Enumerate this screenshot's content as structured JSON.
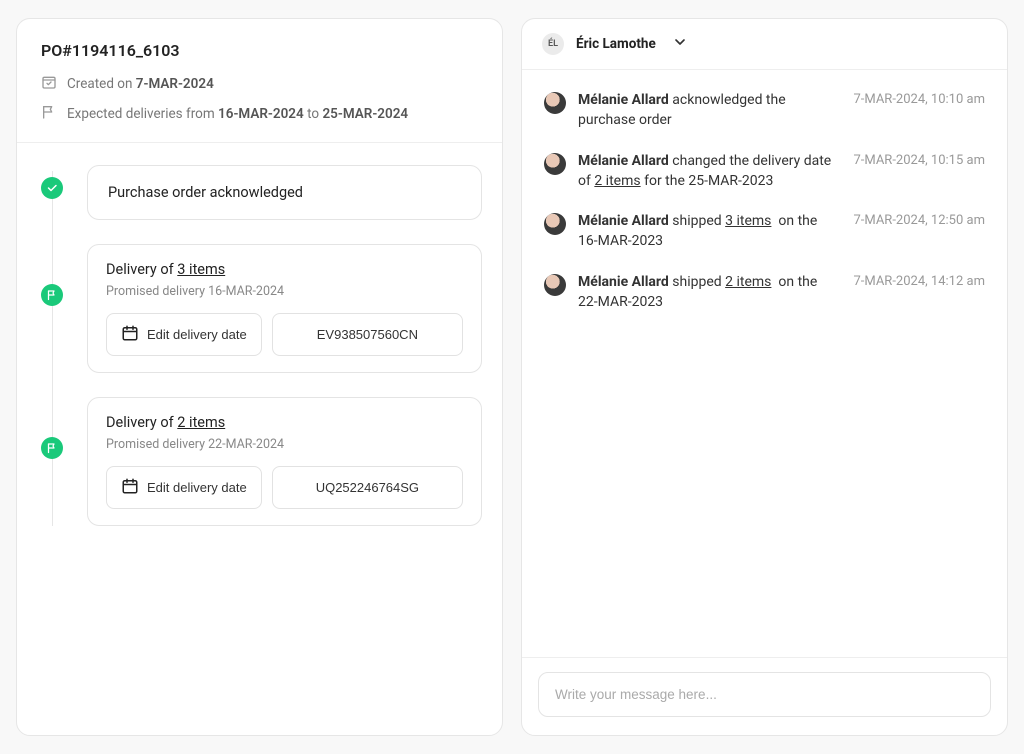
{
  "po": {
    "title": "PO#1194116_6103",
    "created_label": "Created on",
    "created_date": "7-MAR-2024",
    "expected_label_pre": "Expected deliveries from",
    "expected_from": "16-MAR-2024",
    "expected_label_mid": "to",
    "expected_to": "25-MAR-2024"
  },
  "timeline": {
    "ack": "Purchase order acknowledged",
    "edit_label": "Edit delivery date",
    "d1": {
      "title_pre": "Delivery of",
      "items": "3 items",
      "sub_pre": "Promised delivery",
      "sub_date": "16-MAR-2024",
      "tracking": "EV938507560CN"
    },
    "d2": {
      "title_pre": "Delivery of",
      "items": "2 items",
      "sub_pre": "Promised delivery",
      "sub_date": "22-MAR-2024",
      "tracking": "UQ252246764SG"
    }
  },
  "right": {
    "user_initials": "ÉL",
    "user_name": "Éric Lamothe",
    "composer_placeholder": "Write your message here..."
  },
  "activity": {
    "author": "Mélanie Allard",
    "a1": {
      "verb": "acknowledged the purchase order",
      "time": "7-MAR-2024, 10:10 am"
    },
    "a2": {
      "verb_pre": "changed the delivery date of",
      "items": "2 items",
      "verb_post": "for the 25-MAR-2023",
      "time": "7-MAR-2024, 10:15 am"
    },
    "a3": {
      "verb_pre": "shipped",
      "items": "3 items",
      "verb_post": "on the 16-MAR-2023",
      "time": "7-MAR-2024, 12:50 am"
    },
    "a4": {
      "verb_pre": "shipped",
      "items": "2 items",
      "verb_post": "on the 22-MAR-2023",
      "time": "7-MAR-2024, 14:12 am"
    }
  }
}
